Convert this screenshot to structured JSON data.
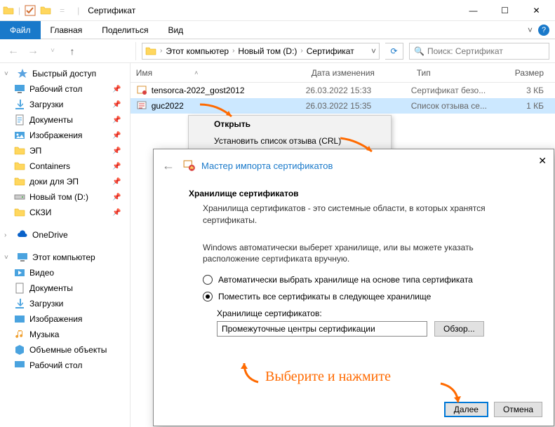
{
  "window": {
    "title": "Сертификат"
  },
  "ribbon": {
    "file": "Файл",
    "home": "Главная",
    "share": "Поделиться",
    "view": "Вид"
  },
  "breadcrumb": {
    "root": "Этот компьютер",
    "drive": "Новый том (D:)",
    "folder": "Сертификат"
  },
  "search": {
    "placeholder": "Поиск: Сертификат"
  },
  "columns": {
    "name": "Имя",
    "date": "Дата изменения",
    "type": "Тип",
    "size": "Размер"
  },
  "files": [
    {
      "name": "tensorca-2022_gost2012",
      "date": "26.03.2022 15:33",
      "type": "Сертификат безо...",
      "size": "3 КБ"
    },
    {
      "name": "guc2022",
      "date": "26.03.2022 15:35",
      "type": "Список отзыва се...",
      "size": "1 КБ"
    }
  ],
  "sidebar": {
    "quick": "Быстрый доступ",
    "items_quick": [
      "Рабочий стол",
      "Загрузки",
      "Документы",
      "Изображения",
      "ЭП",
      "Containers",
      "доки для ЭП",
      "Новый том (D:)",
      "СКЗИ"
    ],
    "onedrive": "OneDrive",
    "thispc": "Этот компьютер",
    "items_pc": [
      "Видео",
      "Документы",
      "Загрузки",
      "Изображения",
      "Музыка",
      "Объемные объекты",
      "Рабочий стол"
    ]
  },
  "context": {
    "open": "Открыть",
    "install": "Установить список отзыва (CRL)"
  },
  "wizard": {
    "title": "Мастер импорта сертификатов",
    "section": "Хранилище сертификатов",
    "desc": "Хранилища сертификатов - это системные области, в которых хранятся сертификаты.",
    "hint": "Windows автоматически выберет хранилище, или вы можете указать расположение сертификата вручную.",
    "opt_auto": "Автоматически выбрать хранилище на основе типа сертификата",
    "opt_place": "Поместить все сертификаты в следующее хранилище",
    "store_label": "Хранилище сертификатов:",
    "store_value": "Промежуточные центры сертификации",
    "browse": "Обзор...",
    "next": "Далее",
    "cancel": "Отмена"
  },
  "annotation": {
    "pick": "Выберите и нажмите"
  }
}
